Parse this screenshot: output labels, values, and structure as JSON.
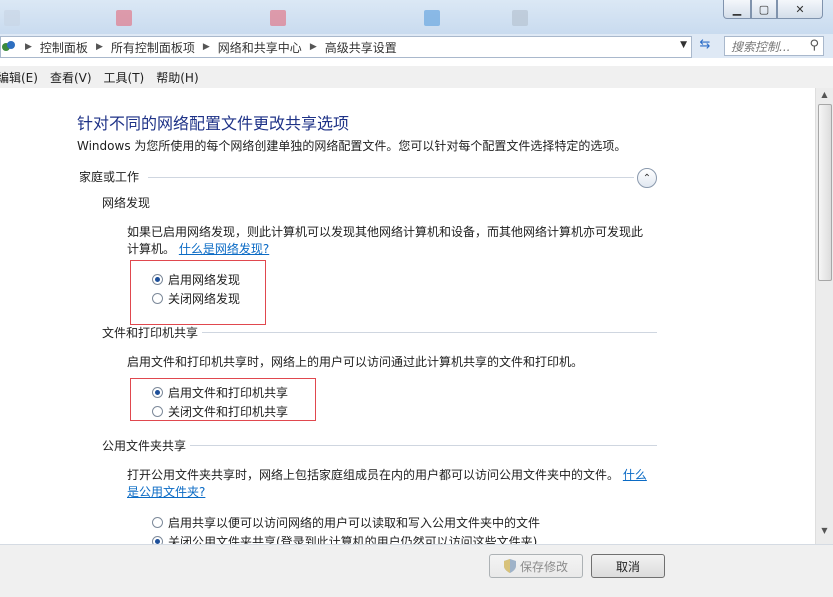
{
  "address": {
    "crumbs": [
      "控制面板",
      "所有控制面板项",
      "网络和共享中心",
      "高级共享设置"
    ],
    "search_placeholder": "搜索控制..."
  },
  "menubar": [
    "编辑(E)",
    "查看(V)",
    "工具(T)",
    "帮助(H)"
  ],
  "page": {
    "title": "针对不同的网络配置文件更改共享选项",
    "description": "Windows 为您所使用的每个网络创建单独的网络配置文件。您可以针对每个配置文件选择特定的选项。",
    "profile_label": "家庭或工作",
    "sections": {
      "network_discovery": {
        "title": "网络发现",
        "text_line1": "如果已启用网络发现，则此计算机可以发现其他网络计算机和设备，而其他网络计算机亦可发现此",
        "text_line2": "计算机。",
        "link": "什么是网络发现?",
        "option_on": "启用网络发现",
        "option_off": "关闭网络发现",
        "selected": "on"
      },
      "file_printer_sharing": {
        "title": "文件和打印机共享",
        "text": "启用文件和打印机共享时，网络上的用户可以访问通过此计算机共享的文件和打印机。",
        "option_on": "启用文件和打印机共享",
        "option_off": "关闭文件和打印机共享",
        "selected": "on"
      },
      "public_folder_sharing": {
        "title": "公用文件夹共享",
        "text_line1": "打开公用文件夹共享时，网络上包括家庭组成员在内的用户都可以访问公用文件夹中的文件。",
        "link1": "什么",
        "link2": "是公用文件夹?",
        "option_on": "启用共享以便可以访问网络的用户可以读取和写入公用文件夹中的文件",
        "option_off": "关闭公用文件夹共享(登录到此计算机的用户仍然可以访问这些文件夹)",
        "selected": "off"
      }
    }
  },
  "footer": {
    "save_label": "保存修改",
    "cancel_label": "取消"
  },
  "colors": {
    "title_blue": "#1e3287",
    "link_blue": "#0b6bc5",
    "highlight_red": "#e0484e"
  }
}
